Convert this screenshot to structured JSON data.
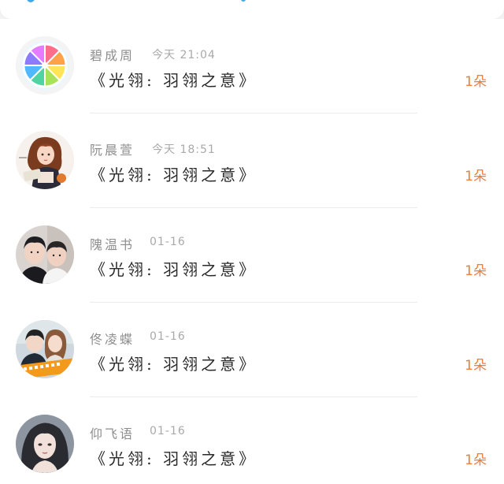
{
  "theme": {
    "accent": "#f07b3c",
    "name_color": "#8e8e8e",
    "time_color": "#a9a9a9",
    "title_color": "#2a2a2a",
    "top_blip": "#44a8e6"
  },
  "items": [
    {
      "name": "碧成周",
      "time": "今天 21:04",
      "title": "《光翎: 羽翎之意》",
      "count": "1朵",
      "avatar": "lemon-slice-avatar"
    },
    {
      "name": "阮晨萱",
      "time": "今天 18:51",
      "title": "《光翎: 羽翎之意》",
      "count": "1朵",
      "avatar": "illustrated-girl-avatar"
    },
    {
      "name": "隗温书",
      "time": "01-16",
      "title": "《光翎: 羽翎之意》",
      "count": "1朵",
      "avatar": "two-boys-photo-avatar"
    },
    {
      "name": "佟凌蝶",
      "time": "01-16",
      "title": "《光翎: 羽翎之意》",
      "count": "1朵",
      "avatar": "couple-photo-avatar"
    },
    {
      "name": "仰飞语",
      "time": "01-16",
      "title": "《光翎: 羽翎之意》",
      "count": "1朵",
      "avatar": "woman-portrait-avatar"
    }
  ]
}
